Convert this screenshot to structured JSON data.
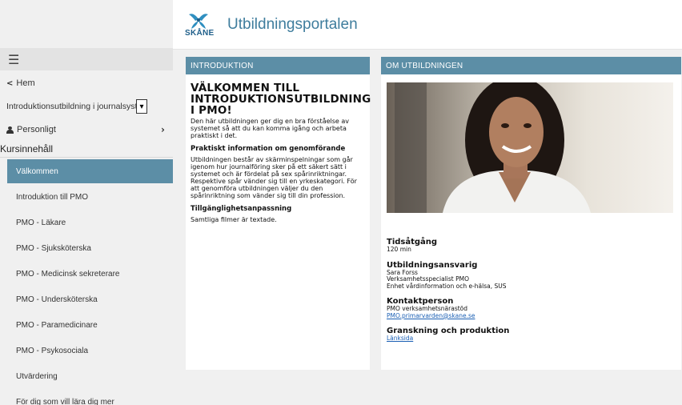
{
  "header": {
    "logo_text": "SKÅNE",
    "title": "Utbildningsportalen"
  },
  "sidebar": {
    "menu_icon": "hamburger-icon",
    "home_label": "Hem",
    "course_select_value": "Introduktionsutbildning i journalsystem",
    "personal_label": "Personligt",
    "section_title": "Kursinnehåll",
    "items": [
      {
        "label": "Välkommen",
        "active": true
      },
      {
        "label": "Introduktion till PMO",
        "active": false
      },
      {
        "label": "PMO - Läkare",
        "active": false
      },
      {
        "label": "PMO - Sjuksköterska",
        "active": false
      },
      {
        "label": "PMO - Medicinsk sekreterare",
        "active": false
      },
      {
        "label": "PMO - Undersköterska",
        "active": false
      },
      {
        "label": "PMO - Paramedicinare",
        "active": false
      },
      {
        "label": "PMO - Psykosociala",
        "active": false
      },
      {
        "label": "Utvärdering",
        "active": false
      },
      {
        "label": "För dig som vill lära dig mer",
        "active": false
      }
    ]
  },
  "intro": {
    "heading": "INTRODUKTION",
    "title": "VÄLKOMMEN TILL INTRODUKTIONSUTBILDNING I PMO!",
    "lead": "Den här utbildningen ger dig en bra förståelse av systemet så att du kan komma igång och arbeta praktiskt i det.",
    "practical_heading": "Praktiskt information om genomförande",
    "practical_text": "Utbildningen består av skärminspelningar som går igenom hur journalföring sker på ett säkert sätt i systemet och är fördelat på sex spårinriktningar. Respektive spår vänder sig till en yrkeskategori. För att genomföra utbildningen väljer du den spårinriktning som vänder sig till din profession.",
    "access_heading": "Tillgänglighetsanpassning",
    "access_text": "Samtliga filmer är textade."
  },
  "about": {
    "heading": "OM UTBILDNINGEN",
    "time_heading": "Tidsåtgång",
    "time_value": "120 min",
    "resp_heading": "Utbildningsansvarig",
    "resp_name": "Sara Forss",
    "resp_role": "Verksamhetsspecialist PMO",
    "resp_unit": "Enhet vårdinformation och e-hälsa, SUS",
    "contact_heading": "Kontaktperson",
    "contact_name": "PMO verksamhetsnärastöd",
    "contact_email": "PMO.primarvarden@skane.se",
    "review_heading": "Granskning och produktion",
    "review_link": "Länksida"
  },
  "colors": {
    "accent": "#5c8ea6",
    "title": "#3f7d9d",
    "link": "#1a5fb4",
    "background": "#f0f0f0"
  }
}
